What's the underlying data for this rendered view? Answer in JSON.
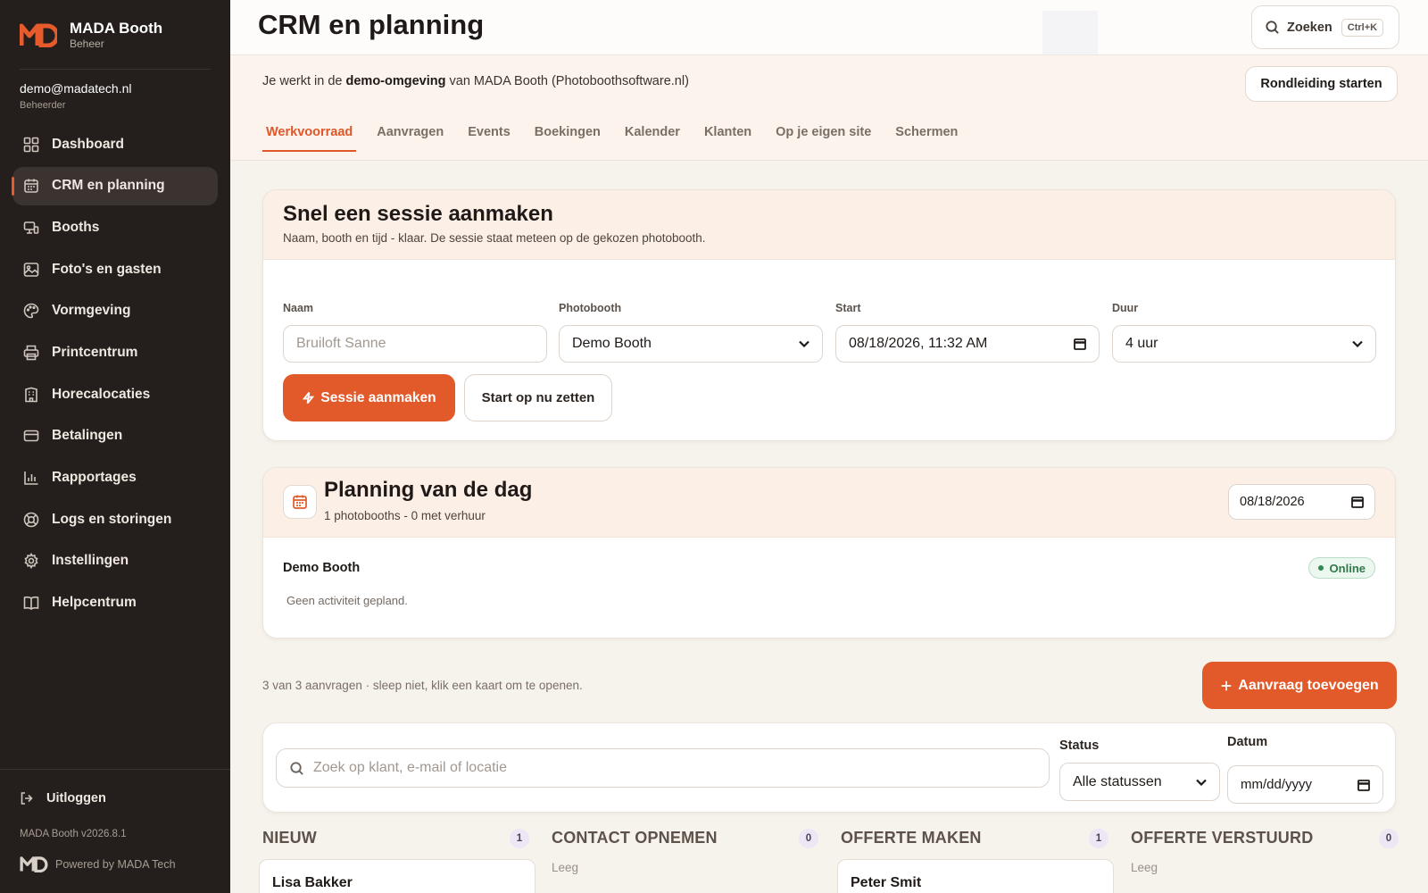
{
  "brand": {
    "name": "MADA Booth",
    "subtitle": "Beheer",
    "accent": "#e25a2a"
  },
  "user": {
    "email": "demo@madatech.nl",
    "role": "Beheerder"
  },
  "nav": [
    {
      "label": "Dashboard",
      "icon": "dashboard-icon"
    },
    {
      "label": "CRM en planning",
      "icon": "calendar-icon",
      "active": true
    },
    {
      "label": "Booths",
      "icon": "booth-icon"
    },
    {
      "label": "Foto's en gasten",
      "icon": "image-icon"
    },
    {
      "label": "Vormgeving",
      "icon": "palette-icon"
    },
    {
      "label": "Printcentrum",
      "icon": "printer-icon"
    },
    {
      "label": "Horecalocaties",
      "icon": "building-icon"
    },
    {
      "label": "Betalingen",
      "icon": "credit-card-icon"
    },
    {
      "label": "Rapportages",
      "icon": "bar-chart-icon"
    },
    {
      "label": "Logs en storingen",
      "icon": "lifebuoy-icon"
    },
    {
      "label": "Instellingen",
      "icon": "gear-icon"
    },
    {
      "label": "Helpcentrum",
      "icon": "book-icon"
    }
  ],
  "sidebar_footer": {
    "logout": "Uitloggen",
    "version": "MADA Booth v2026.8.1",
    "powered": "Powered by MADA Tech"
  },
  "header": {
    "title": "CRM en planning",
    "search_label": "Zoeken",
    "search_shortcut": "Ctrl+K"
  },
  "demo": {
    "prefix": "Je werkt in de ",
    "highlight": "demo-omgeving",
    "suffix": " van MADA Booth (Photoboothsoftware.nl)",
    "tour_button": "Rondleiding starten"
  },
  "tabs": [
    "Werkvoorraad",
    "Aanvragen",
    "Events",
    "Boekingen",
    "Kalender",
    "Klanten",
    "Op je eigen site",
    "Schermen"
  ],
  "quick_session": {
    "title": "Snel een sessie aanmaken",
    "subtitle": "Naam, booth en tijd - klaar. De sessie staat meteen op de gekozen photobooth.",
    "name_label": "Naam",
    "name_placeholder": "Bruiloft Sanne",
    "booth_label": "Photobooth",
    "booth_value": "Demo Booth",
    "start_label": "Start",
    "start_value": "08/18/2026, 11:32 AM",
    "duration_label": "Duur",
    "duration_value": "4 uur",
    "create_button": "Sessie aanmaken",
    "now_button": "Start op nu zetten"
  },
  "day_planning": {
    "title": "Planning van de dag",
    "subtitle": "1 photobooths - 0 met verhuur",
    "date": "08/18/2026",
    "booth": "Demo Booth",
    "status": "Online",
    "empty": "Geen activiteit gepland."
  },
  "requests": {
    "count_text": "3 van 3 aanvragen · sleep niet, klik een kaart om te openen.",
    "add_button": "Aanvraag toevoegen",
    "search_placeholder": "Zoek op klant, e-mail of locatie",
    "status_label": "Status",
    "status_value": "Alle statussen",
    "date_label": "Datum",
    "date_placeholder": "mm/dd/yyyy"
  },
  "pipeline": [
    {
      "title": "NIEUW",
      "count": "1",
      "card": "Lisa Bakker"
    },
    {
      "title": "CONTACT OPNEMEN",
      "count": "0",
      "empty": "Leeg"
    },
    {
      "title": "OFFERTE MAKEN",
      "count": "1",
      "card": "Peter Smit"
    },
    {
      "title": "OFFERTE VERSTUURD",
      "count": "0",
      "empty": "Leeg"
    }
  ]
}
